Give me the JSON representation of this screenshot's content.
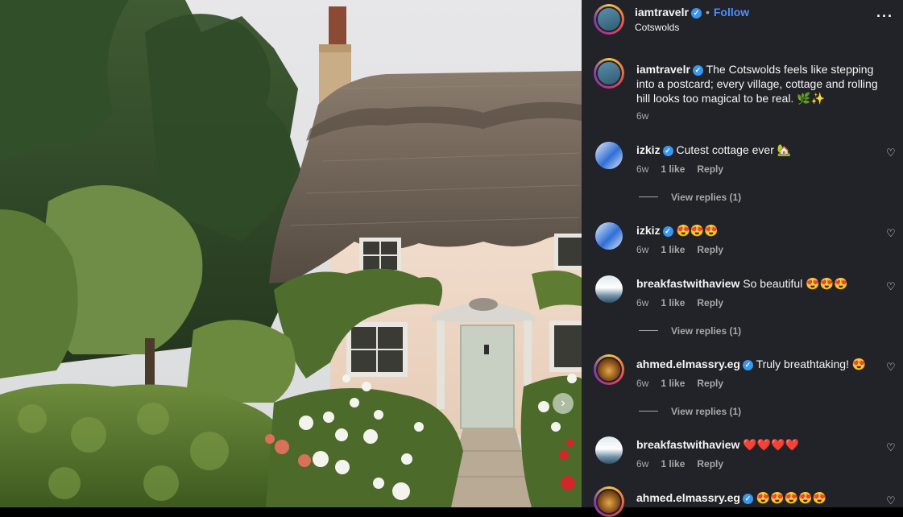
{
  "post": {
    "username": "iamtravelr",
    "follow_label": "Follow",
    "separator": "•",
    "location": "Cotswolds",
    "more_label": "···",
    "caption_username": "iamtravelr",
    "caption_text": "The Cotswolds feels like stepping into a postcard; every village, cottage and rolling hill looks too magical to be real. 🌿✨",
    "caption_time": "6w"
  },
  "comments": [
    {
      "username": "izkiz",
      "verified": true,
      "text": "Cutest cottage ever 🏡",
      "time": "6w",
      "likes": "1 like",
      "reply": "Reply",
      "view_replies": "View replies (1)"
    },
    {
      "username": "izkiz",
      "verified": true,
      "text": "😍😍😍",
      "time": "6w",
      "likes": "1 like",
      "reply": "Reply"
    },
    {
      "username": "breakfastwithaview",
      "verified": false,
      "text": "So beautiful 😍😍😍",
      "time": "6w",
      "likes": "1 like",
      "reply": "Reply",
      "view_replies": "View replies (1)"
    },
    {
      "username": "ahmed.elmassry.eg",
      "verified": true,
      "text": "Truly breathtaking! 😍",
      "time": "6w",
      "likes": "1 like",
      "reply": "Reply",
      "view_replies": "View replies (1)"
    },
    {
      "username": "breakfastwithaview",
      "verified": false,
      "text": "❤️❤️❤️❤️",
      "time": "6w",
      "likes": "1 like",
      "reply": "Reply"
    },
    {
      "username": "ahmed.elmassry.eg",
      "verified": true,
      "text": "😍😍😍😍😍"
    }
  ],
  "icons": {
    "verified": "✓",
    "heart": "♡",
    "next": "›"
  },
  "colors": {
    "sidebar_bg": "#212328",
    "follow": "#4f8dff",
    "verified": "#3897f0",
    "muted": "#a8a8a8"
  }
}
